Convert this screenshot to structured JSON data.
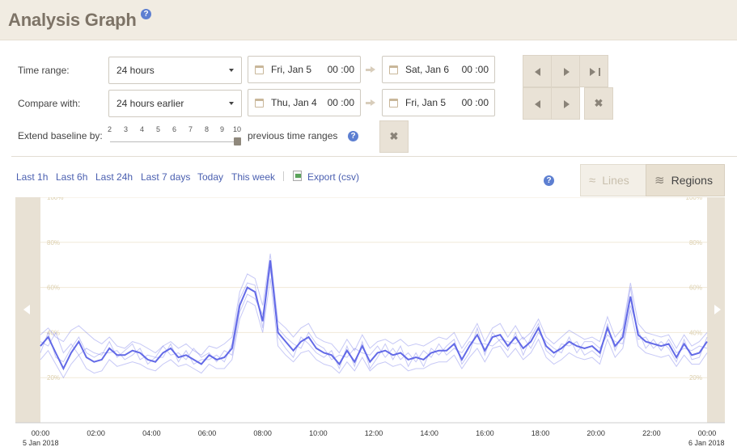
{
  "header": {
    "title": "Analysis Graph",
    "help": "?"
  },
  "controls": {
    "time_range_label": "Time range:",
    "time_range_value": "24 hours",
    "range_start": {
      "date": "Fri, Jan 5",
      "time": "00 :00"
    },
    "range_end": {
      "date": "Sat, Jan 6",
      "time": "00 :00"
    },
    "compare_label": "Compare with:",
    "compare_value": "24 hours earlier",
    "compare_start": {
      "date": "Thu, Jan 4",
      "time": "00 :00"
    },
    "compare_end": {
      "date": "Fri, Jan 5",
      "time": "00 :00"
    },
    "extend_label": "Extend baseline by:",
    "extend_ticks": [
      "2",
      "3",
      "4",
      "5",
      "6",
      "7",
      "8",
      "9",
      "10"
    ],
    "extend_value": 10,
    "extend_suffix": "previous time ranges",
    "clear_glyph": "✖"
  },
  "quick_links": [
    "Last 1h",
    "Last 6h",
    "Last 24h",
    "Last 7 days",
    "Today",
    "This week"
  ],
  "export_label": "Export (csv)",
  "view_toggle": {
    "lines": "Lines",
    "regions": "Regions",
    "active": "regions"
  },
  "icons": {
    "help": "help-icon",
    "calendar": "calendar-icon",
    "prev": "prev-icon",
    "next": "next-icon",
    "last": "skip-to-end-icon",
    "clear": "close-icon",
    "export": "export-csv-icon",
    "lines": "lines-icon",
    "regions": "regions-icon",
    "scroll_left": "chevron-left-icon",
    "scroll_right": "chevron-right-icon"
  },
  "colors": {
    "header_bg": "#f1ece2",
    "title": "#7d7366",
    "link": "#4a5fb0",
    "series": "#5b62e6",
    "button_bg": "#e9e2d6",
    "help": "#5d7fd1"
  },
  "chart_data": {
    "type": "line",
    "y_ticks": [
      "100%",
      "80%",
      "60%",
      "40%",
      "20%"
    ],
    "ylim": [
      0,
      100
    ],
    "x_ticks": [
      "00:00",
      "02:00",
      "04:00",
      "06:00",
      "08:00",
      "10:00",
      "12:00",
      "14:00",
      "16:00",
      "18:00",
      "20:00",
      "22:00",
      "00:00"
    ],
    "x_start_sub": "5 Jan 2018",
    "x_end_sub": "6 Jan 2018",
    "series": [
      {
        "emphasis": "primary",
        "values": [
          34,
          38,
          31,
          24,
          31,
          36,
          29,
          27,
          28,
          33,
          30,
          30,
          32,
          31,
          28,
          27,
          31,
          33,
          29,
          30,
          28,
          26,
          30,
          28,
          29,
          33,
          52,
          60,
          58,
          45,
          72,
          40,
          36,
          32,
          36,
          38,
          33,
          31,
          30,
          26,
          32,
          27,
          34,
          27,
          31,
          32,
          30,
          31,
          28,
          29,
          28,
          31,
          32,
          32,
          35,
          28,
          34,
          39,
          32,
          38,
          39,
          34,
          38,
          33,
          36,
          42,
          34,
          31,
          33,
          36,
          34,
          33,
          34,
          31,
          42,
          34,
          38,
          56,
          39,
          36,
          35,
          34,
          35,
          29,
          35,
          30,
          31,
          36
        ]
      },
      {
        "emphasis": "secondary",
        "values": [
          39,
          42,
          38,
          36,
          41,
          43,
          40,
          37,
          35,
          38,
          34,
          33,
          36,
          35,
          33,
          31,
          34,
          36,
          33,
          35,
          32,
          30,
          34,
          33,
          35,
          38,
          58,
          66,
          64,
          52,
          75,
          45,
          42,
          38,
          42,
          44,
          38,
          36,
          35,
          31,
          37,
          32,
          39,
          33,
          36,
          37,
          35,
          37,
          34,
          35,
          34,
          36,
          38,
          37,
          40,
          33,
          38,
          44,
          36,
          42,
          44,
          38,
          43,
          37,
          40,
          46,
          38,
          35,
          38,
          41,
          39,
          37,
          38,
          36,
          47,
          38,
          42,
          62,
          44,
          40,
          39,
          38,
          39,
          33,
          39,
          34,
          36,
          40
        ]
      },
      {
        "emphasis": "secondary",
        "values": [
          28,
          32,
          26,
          20,
          26,
          30,
          24,
          22,
          23,
          28,
          25,
          26,
          27,
          26,
          24,
          23,
          26,
          28,
          25,
          26,
          24,
          22,
          26,
          24,
          24,
          28,
          46,
          54,
          52,
          40,
          64,
          34,
          30,
          27,
          31,
          32,
          28,
          26,
          25,
          22,
          27,
          23,
          29,
          23,
          26,
          27,
          25,
          26,
          23,
          24,
          24,
          26,
          27,
          27,
          30,
          24,
          29,
          33,
          27,
          33,
          34,
          29,
          33,
          28,
          31,
          37,
          29,
          26,
          28,
          31,
          29,
          28,
          29,
          26,
          37,
          29,
          33,
          50,
          34,
          31,
          30,
          29,
          30,
          25,
          30,
          26,
          26,
          31
        ]
      },
      {
        "emphasis": "secondary",
        "values": [
          36,
          34,
          40,
          31,
          35,
          30,
          33,
          31,
          30,
          36,
          29,
          32,
          35,
          28,
          30,
          29,
          34,
          30,
          31,
          28,
          33,
          29,
          31,
          27,
          32,
          30,
          49,
          57,
          55,
          48,
          68,
          42,
          38,
          35,
          33,
          40,
          35,
          33,
          28,
          30,
          29,
          33,
          31,
          30,
          34,
          29,
          33,
          28,
          31,
          27,
          32,
          29,
          35,
          30,
          33,
          31,
          36,
          35,
          35,
          34,
          37,
          36,
          35,
          38,
          33,
          40,
          36,
          33,
          31,
          38,
          31,
          36,
          36,
          33,
          39,
          36,
          35,
          52,
          41,
          33,
          37,
          32,
          37,
          31,
          33,
          32,
          34,
          33
        ]
      },
      {
        "emphasis": "secondary",
        "values": [
          31,
          40,
          29,
          27,
          33,
          38,
          31,
          29,
          31,
          31,
          32,
          28,
          30,
          33,
          26,
          29,
          29,
          35,
          27,
          32,
          26,
          28,
          28,
          30,
          27,
          35,
          55,
          62,
          61,
          42,
          70,
          38,
          33,
          29,
          38,
          35,
          31,
          29,
          32,
          24,
          34,
          25,
          36,
          24,
          29,
          35,
          28,
          34,
          25,
          31,
          25,
          33,
          30,
          34,
          37,
          26,
          31,
          42,
          30,
          40,
          36,
          32,
          40,
          30,
          38,
          44,
          32,
          29,
          35,
          34,
          36,
          30,
          32,
          29,
          44,
          32,
          40,
          60,
          37,
          38,
          33,
          36,
          33,
          27,
          37,
          28,
          29,
          38
        ]
      }
    ]
  }
}
